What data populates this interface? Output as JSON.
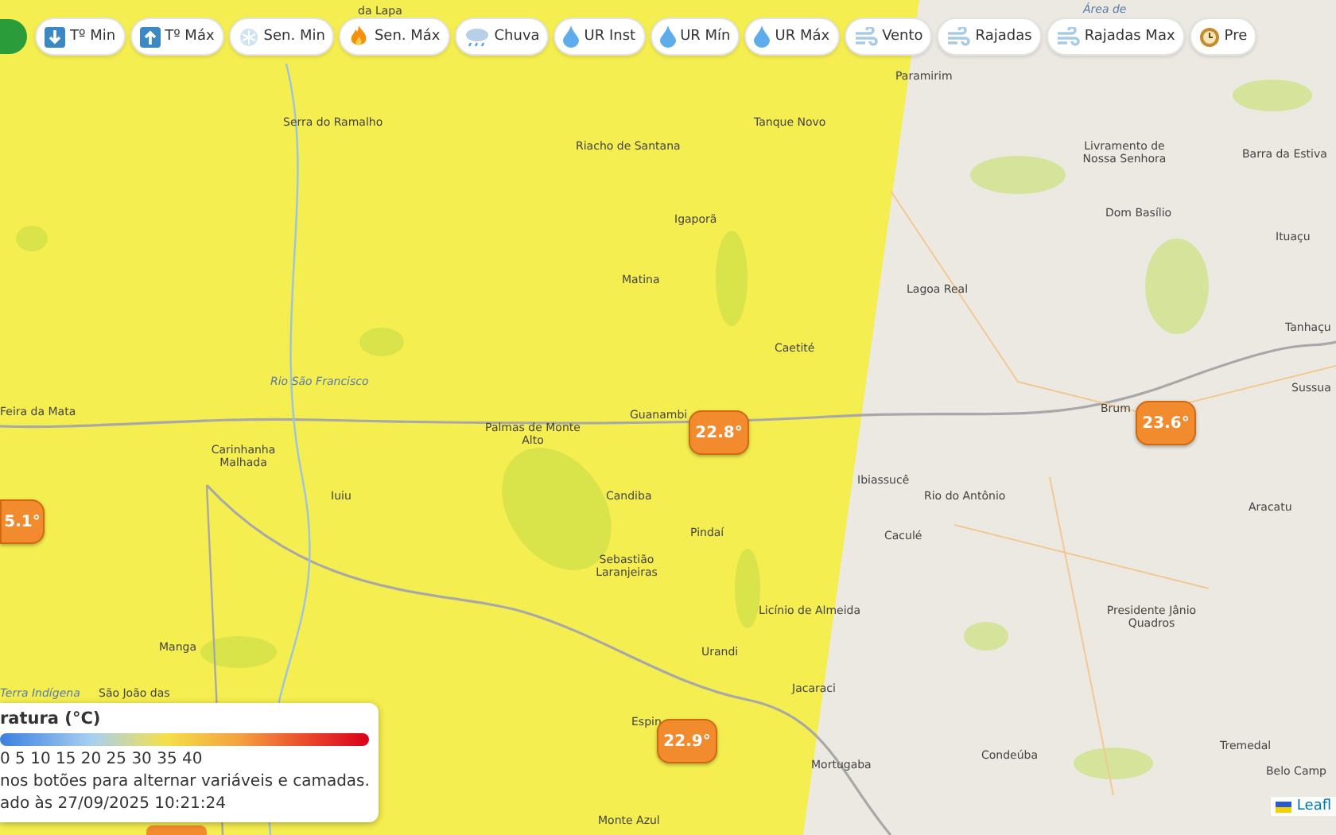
{
  "toolbar": {
    "buttons": [
      {
        "label": "Tº Min",
        "kind": "down",
        "selected": false
      },
      {
        "label": "Tº Máx",
        "kind": "up",
        "selected": false
      },
      {
        "label": "Sen. Min",
        "kind": "snow",
        "selected": false
      },
      {
        "label": "Sen. Máx",
        "kind": "fire",
        "selected": false
      },
      {
        "label": "Chuva",
        "kind": "rain",
        "selected": false
      },
      {
        "label": "UR Inst",
        "kind": "drop",
        "selected": false
      },
      {
        "label": "UR Mín",
        "kind": "drop",
        "selected": false
      },
      {
        "label": "UR Máx",
        "kind": "drop",
        "selected": false
      },
      {
        "label": "Vento",
        "kind": "wind",
        "selected": false
      },
      {
        "label": "Rajadas",
        "kind": "wind",
        "selected": false
      },
      {
        "label": "Rajadas Max",
        "kind": "wind",
        "selected": false
      },
      {
        "label": "Pre",
        "kind": "clock",
        "selected": false
      }
    ]
  },
  "map": {
    "places": [
      {
        "name": "da Lapa"
      },
      {
        "name": "Paramirim"
      },
      {
        "name": "Serra do Ramalho"
      },
      {
        "name": "Riacho de Santana"
      },
      {
        "name": "Tanque Novo"
      },
      {
        "name": "Igaporã"
      },
      {
        "name": "Matina"
      },
      {
        "name": "Caetité"
      },
      {
        "name": "Rio São Francisco",
        "kind": "river"
      },
      {
        "name": "Feira da Mata"
      },
      {
        "name": "Carinhanha Malhada"
      },
      {
        "name": "Palmas de Monte Alto"
      },
      {
        "name": "Guanambi"
      },
      {
        "name": "Iuiu"
      },
      {
        "name": "Candiba"
      },
      {
        "name": "Pindaí"
      },
      {
        "name": "Sebastião Laranjeiras"
      },
      {
        "name": "Licínio de Almeida"
      },
      {
        "name": "Manga"
      },
      {
        "name": "Urandi"
      },
      {
        "name": "Terra Indígena",
        "kind": "river"
      },
      {
        "name": "São João das"
      },
      {
        "name": "Jacaraci"
      },
      {
        "name": "Espin"
      },
      {
        "name": "Mortugaba"
      },
      {
        "name": "Monte Azul"
      },
      {
        "name": "Área de",
        "kind": "river"
      },
      {
        "name": "Livramento de Nossa Senhora"
      },
      {
        "name": "Barra da Estiva"
      },
      {
        "name": "Dom Basílio"
      },
      {
        "name": "Ituaçu"
      },
      {
        "name": "Lagoa Real"
      },
      {
        "name": "Tanhaçu"
      },
      {
        "name": "Sussua"
      },
      {
        "name": "Brum"
      },
      {
        "name": "Ibiassucê"
      },
      {
        "name": "Rio do Antônio"
      },
      {
        "name": "Caculé"
      },
      {
        "name": "Aracatu"
      },
      {
        "name": "Presidente Jânio Quadros"
      },
      {
        "name": "Condeúba"
      },
      {
        "name": "Tremedal"
      },
      {
        "name": "Belo Camp"
      }
    ],
    "markers": [
      {
        "value": "22.8°"
      },
      {
        "value": "23.6°"
      },
      {
        "value": "5.1°"
      },
      {
        "value": "22.9°"
      }
    ],
    "attribution": "Leafl"
  },
  "legend": {
    "title": "ratura (°C)",
    "scale": "0 5 10 15 20 25 30 35 40",
    "hint": "nos botões para alternar variáveis e camadas.",
    "updated": "ado às 27/09/2025 10:21:24"
  }
}
